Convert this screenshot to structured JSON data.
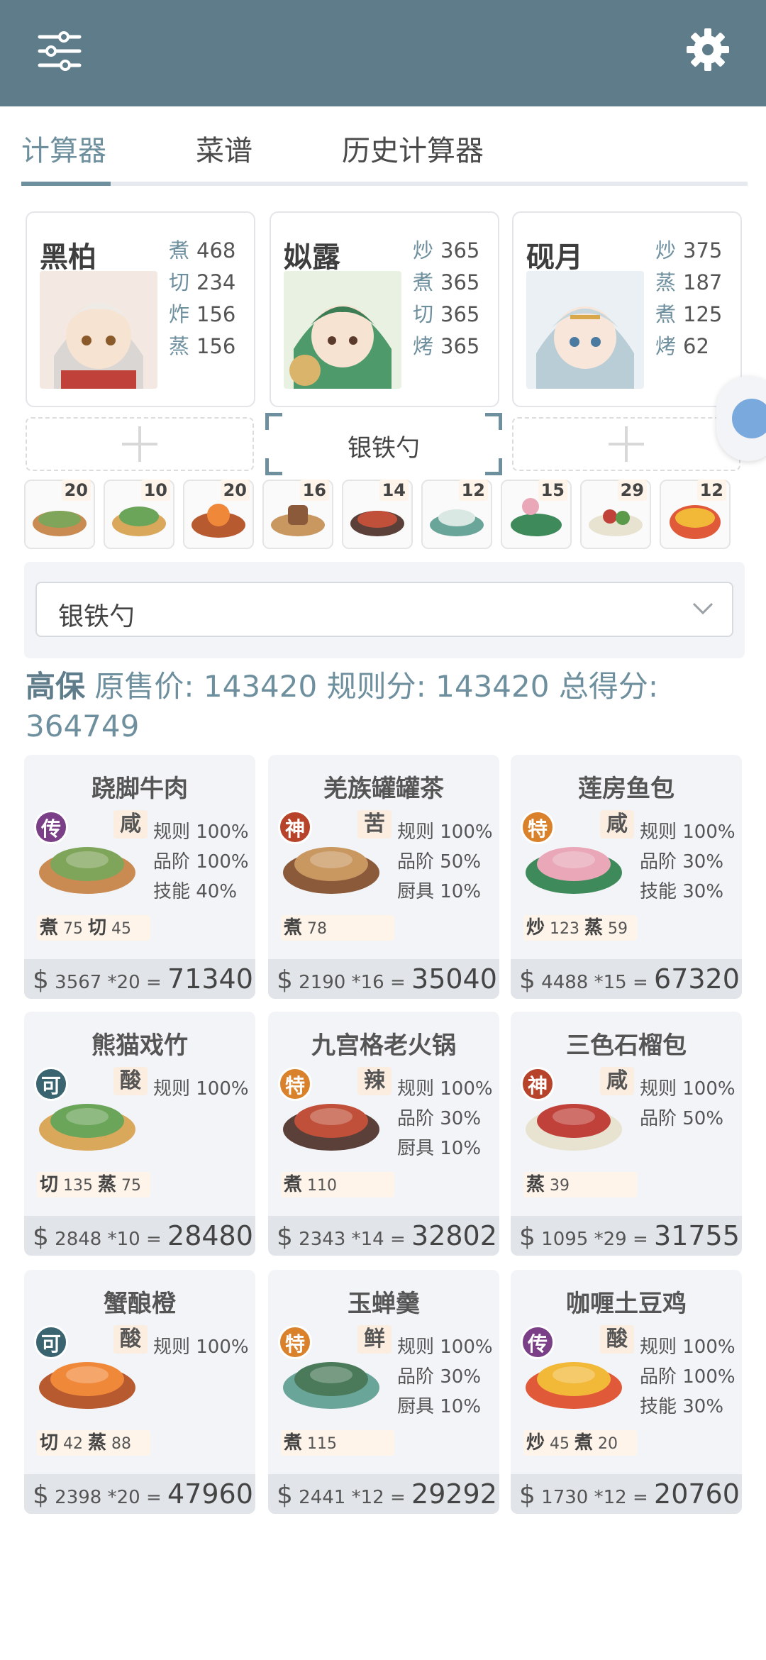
{
  "header": {
    "menu_icon": "sliders-icon",
    "settings_icon": "gear-icon"
  },
  "tabs": [
    {
      "label": "计算器",
      "active": true
    },
    {
      "label": "菜谱",
      "active": false
    },
    {
      "label": "历史计算器",
      "active": false
    }
  ],
  "chefs": [
    {
      "name": "黑柏",
      "stats": [
        {
          "k": "煮",
          "v": "468"
        },
        {
          "k": "切",
          "v": "234"
        },
        {
          "k": "炸",
          "v": "156"
        },
        {
          "k": "蒸",
          "v": "156"
        }
      ]
    },
    {
      "name": "姒露",
      "stats": [
        {
          "k": "炒",
          "v": "365"
        },
        {
          "k": "煮",
          "v": "365"
        },
        {
          "k": "切",
          "v": "365"
        },
        {
          "k": "烤",
          "v": "365"
        }
      ]
    },
    {
      "name": "砚月",
      "stats": [
        {
          "k": "炒",
          "v": "375"
        },
        {
          "k": "蒸",
          "v": "187"
        },
        {
          "k": "煮",
          "v": "125"
        },
        {
          "k": "烤",
          "v": "62"
        }
      ]
    }
  ],
  "equip_slot": {
    "label": "银铁勺"
  },
  "mini_dishes": [
    "20",
    "10",
    "20",
    "16",
    "14",
    "12",
    "15",
    "29",
    "12"
  ],
  "equipment_select": {
    "value": "银铁勺"
  },
  "summary": {
    "name": "高保",
    "orig_label": "原售价:",
    "orig_value": "143420",
    "rule_label": "规则分:",
    "rule_value": "143420",
    "total_label": "总得分:",
    "total_value": "364749"
  },
  "dishes": [
    {
      "name": "跷脚牛肉",
      "rarity": "传",
      "rarity_color": "#7a3f86",
      "taste": "咸",
      "buffs": [
        "规则 100%",
        "品阶 100%",
        "技能 40%"
      ],
      "skills": [
        {
          "k": "煮",
          "v": "75"
        },
        {
          "k": "切",
          "v": "45"
        }
      ],
      "price": "3567",
      "qty": "*20",
      "total": "71340",
      "img_colors": [
        "#c98b52",
        "#7fa55a"
      ]
    },
    {
      "name": "羌族罐罐茶",
      "rarity": "神",
      "rarity_color": "#b7442a",
      "taste": "苦",
      "buffs": [
        "规则 100%",
        "品阶 50%",
        "厨具 10%"
      ],
      "skills": [
        {
          "k": "煮",
          "v": "78"
        }
      ],
      "price": "2190",
      "qty": "*16",
      "total": "35040",
      "img_colors": [
        "#8a5a3a",
        "#c99760"
      ]
    },
    {
      "name": "莲房鱼包",
      "rarity": "特",
      "rarity_color": "#d9822b",
      "taste": "咸",
      "buffs": [
        "规则 100%",
        "品阶 30%",
        "技能 30%"
      ],
      "skills": [
        {
          "k": "炒",
          "v": "123"
        },
        {
          "k": "蒸",
          "v": "59"
        }
      ],
      "price": "4488",
      "qty": "*15",
      "total": "67320",
      "img_colors": [
        "#3e8a5a",
        "#e9a7b8"
      ]
    },
    {
      "name": "熊猫戏竹",
      "rarity": "可",
      "rarity_color": "#3a6470",
      "taste": "酸",
      "buffs": [
        "规则 100%"
      ],
      "skills": [
        {
          "k": "切",
          "v": "135"
        },
        {
          "k": "蒸",
          "v": "75"
        }
      ],
      "price": "2848",
      "qty": "*10",
      "total": "28480",
      "img_colors": [
        "#d9a85a",
        "#6aa55a"
      ]
    },
    {
      "name": "九宫格老火锅",
      "rarity": "特",
      "rarity_color": "#d9822b",
      "taste": "辣",
      "buffs": [
        "规则 100%",
        "品阶 30%",
        "厨具 10%"
      ],
      "skills": [
        {
          "k": "煮",
          "v": "110"
        }
      ],
      "price": "2343",
      "qty": "*14",
      "total": "32802",
      "img_colors": [
        "#5a4038",
        "#c0503a"
      ]
    },
    {
      "name": "三色石榴包",
      "rarity": "神",
      "rarity_color": "#b7442a",
      "taste": "咸",
      "buffs": [
        "规则 100%",
        "品阶 50%"
      ],
      "skills": [
        {
          "k": "蒸",
          "v": "39"
        }
      ],
      "price": "1095",
      "qty": "*29",
      "total": "31755",
      "img_colors": [
        "#e8e2d0",
        "#c0403a"
      ]
    },
    {
      "name": "蟹酿橙",
      "rarity": "可",
      "rarity_color": "#3a6470",
      "taste": "酸",
      "buffs": [
        "规则 100%"
      ],
      "skills": [
        {
          "k": "切",
          "v": "42"
        },
        {
          "k": "蒸",
          "v": "88"
        }
      ],
      "price": "2398",
      "qty": "*20",
      "total": "47960",
      "img_colors": [
        "#b85a30",
        "#f0883a"
      ]
    },
    {
      "name": "玉蝉羹",
      "rarity": "特",
      "rarity_color": "#d9822b",
      "taste": "鲜",
      "buffs": [
        "规则 100%",
        "品阶 30%",
        "厨具 10%"
      ],
      "skills": [
        {
          "k": "煮",
          "v": "115"
        }
      ],
      "price": "2441",
      "qty": "*12",
      "total": "29292",
      "img_colors": [
        "#6aa59a",
        "#4a7a5a"
      ]
    },
    {
      "name": "咖喱土豆鸡",
      "rarity": "传",
      "rarity_color": "#7a3f86",
      "taste": "酸",
      "buffs": [
        "规则 100%",
        "品阶 100%",
        "技能 30%"
      ],
      "skills": [
        {
          "k": "炒",
          "v": "45"
        },
        {
          "k": "煮",
          "v": "20"
        }
      ],
      "price": "1730",
      "qty": "*12",
      "total": "20760",
      "img_colors": [
        "#e05a3a",
        "#f2b838"
      ]
    }
  ]
}
